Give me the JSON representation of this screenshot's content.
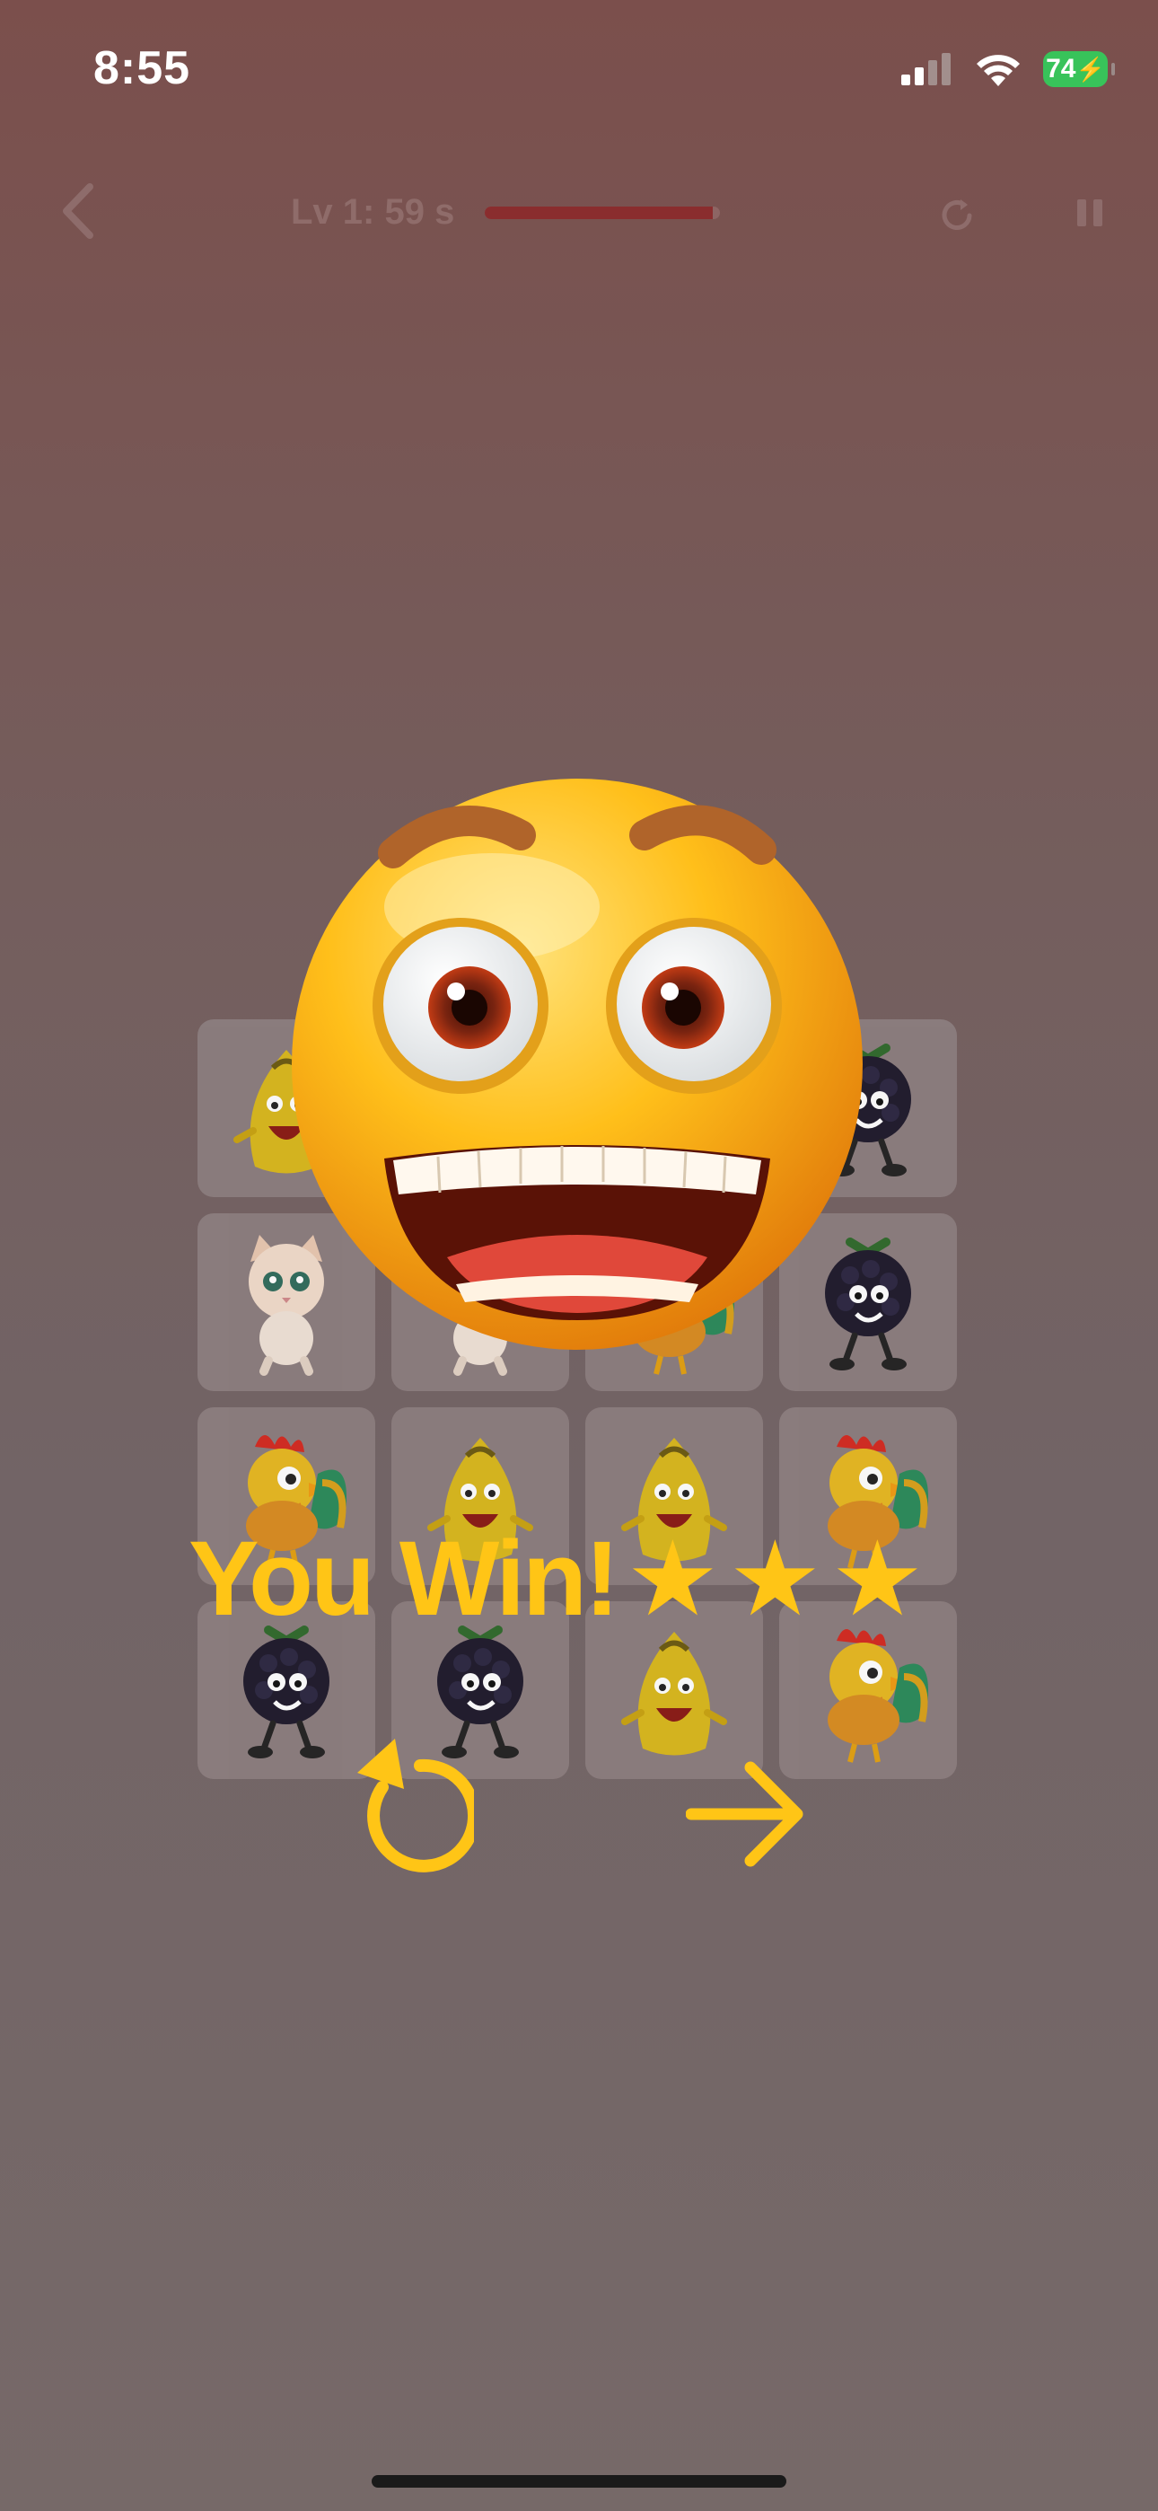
{
  "status_bar": {
    "time": "8:55",
    "battery": "74"
  },
  "header": {
    "level_timer": "Lv 1: 59 s",
    "timer_progress": 0.97
  },
  "board": {
    "tiles": [
      [
        "banana",
        "",
        "",
        "blackberry"
      ],
      [
        "cat",
        "cat",
        "rooster",
        "blackberry"
      ],
      [
        "rooster",
        "banana",
        "banana",
        "rooster"
      ],
      [
        "blackberry",
        "blackberry",
        "banana",
        "rooster"
      ]
    ]
  },
  "result": {
    "title": "You Win!",
    "stars": [
      "★",
      "★",
      "★"
    ],
    "rating": 3
  },
  "colors": {
    "accent": "#ffc516",
    "timer_fill": "#8a2d2e",
    "battery": "#38c35a"
  },
  "icons": {
    "back": "chevron-left-icon",
    "restart": "refresh-icon",
    "pause": "pause-icon",
    "replay": "replay-icon",
    "next": "arrow-right-icon"
  }
}
